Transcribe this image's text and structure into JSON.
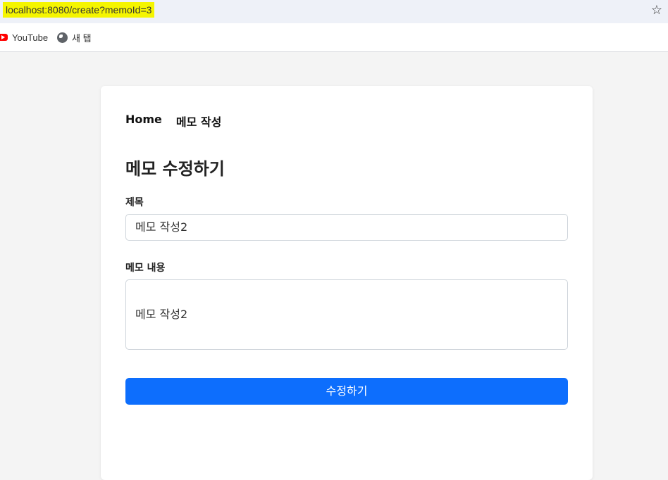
{
  "browser": {
    "url": "localhost:8080/create?memoId=3",
    "bookmarks": [
      {
        "label": "YouTube",
        "icon": "youtube-icon"
      },
      {
        "label": "새 탭",
        "icon": "globe-icon"
      }
    ]
  },
  "nav": {
    "home": "Home",
    "create": "메모 작성"
  },
  "page": {
    "title": "메모 수정하기"
  },
  "form": {
    "title_label": "제목",
    "title_value": "메모 작성2",
    "content_label": "메모 내용",
    "content_value": "메모 작성2",
    "submit_label": "수정하기"
  },
  "colors": {
    "primary": "#0d6efd",
    "url_highlight": "#f5f500",
    "background": "#f4f4f4"
  }
}
